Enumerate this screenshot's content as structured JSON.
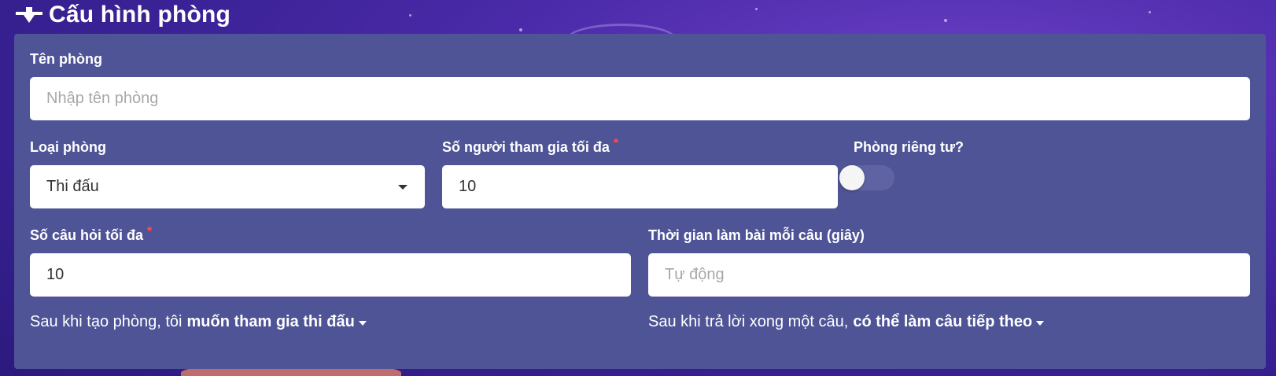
{
  "header": {
    "title": "Cấu hình phòng",
    "icon": "pin-icon"
  },
  "form": {
    "room_name": {
      "label": "Tên phòng",
      "placeholder": "Nhập tên phòng",
      "value": ""
    },
    "room_type": {
      "label": "Loại phòng",
      "selected": "Thi đấu"
    },
    "max_participants": {
      "label": "Số người tham gia tối đa",
      "required_mark": "*",
      "value": "10"
    },
    "private_room": {
      "label": "Phòng riêng tư?",
      "enabled": false
    },
    "max_questions": {
      "label": "Số câu hỏi tối đa",
      "required_mark": "*",
      "value": "10"
    },
    "time_per_question": {
      "label": "Thời gian làm bài mỗi câu (giây)",
      "placeholder": "Tự động",
      "value": ""
    },
    "after_create": {
      "prefix": "Sau khi tạo phòng, tôi",
      "option": "muốn tham gia thi đấu"
    },
    "after_answer": {
      "prefix": "Sau khi trả lời xong một câu,",
      "option": "có thể làm câu tiếp theo"
    }
  },
  "colors": {
    "panel": "#4f5496",
    "required": "#ff4d4f",
    "background": "#3a2296"
  }
}
